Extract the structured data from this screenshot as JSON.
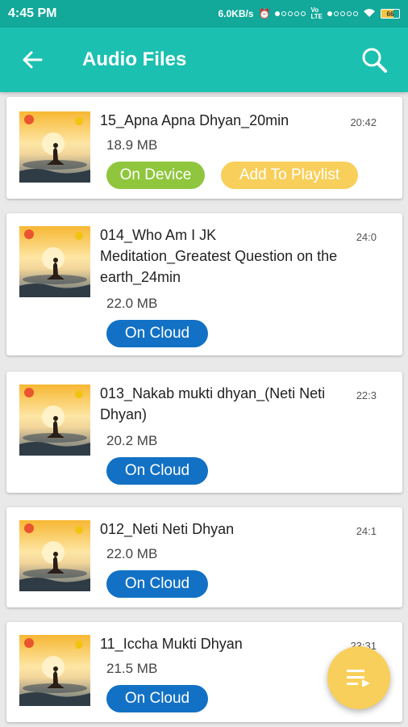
{
  "status_bar": {
    "time": "4:45 PM",
    "net_speed": "6.0KB/s",
    "battery": "66"
  },
  "app_bar": {
    "title": "Audio Files",
    "back_icon": "arrow-left-icon",
    "search_icon": "search-icon"
  },
  "files": [
    {
      "name": "15_Apna Apna Dhyan_20min",
      "duration": "20:42",
      "size": "18.9 MB",
      "buttons": [
        "On Device",
        "Add To Playlist"
      ]
    },
    {
      "name": "014_Who Am I JK Meditation_Greatest Question on the earth_24min",
      "duration": "24:0",
      "size": "22.0 MB",
      "buttons": [
        "On Cloud"
      ]
    },
    {
      "name": "013_Nakab mukti dhyan_(Neti Neti Dhyan)",
      "duration": "22:3",
      "size": "20.2 MB",
      "buttons": [
        "On Cloud"
      ]
    },
    {
      "name": "012_Neti Neti Dhyan",
      "duration": "24:1",
      "size": "22.0 MB",
      "buttons": [
        "On Cloud"
      ]
    },
    {
      "name": "11_Iccha Mukti Dhyan",
      "duration": "23:31",
      "size": "21.5 MB",
      "buttons": [
        "On Cloud"
      ]
    }
  ],
  "fab": {
    "icon": "playlist-icon"
  },
  "colors": {
    "status_bar": "#12a89a",
    "app_bar": "#1cc0b0",
    "on_device": "#8fc63d",
    "playlist": "#f8cf5a",
    "cloud": "#1271c4"
  }
}
